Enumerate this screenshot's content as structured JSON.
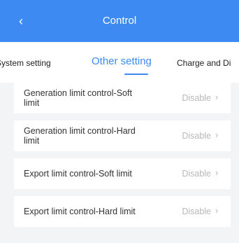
{
  "header": {
    "title": "Control",
    "back_icon": "chevron-left-icon"
  },
  "tabs": [
    {
      "label": "System setting"
    },
    {
      "label": "Other setting",
      "active": true
    },
    {
      "label": "Charge and Di"
    }
  ],
  "items": [
    {
      "label": "Generation limit control-Soft limit",
      "value": "Disable"
    },
    {
      "label": "Generation limit control-Hard limit",
      "value": "Disable"
    },
    {
      "label": "Export limit control-Soft limit",
      "value": "Disable"
    },
    {
      "label": "Export limit control-Hard limit",
      "value": "Disable"
    }
  ],
  "colors": {
    "primary": "#3d8bf2",
    "background": "#f3f4f6",
    "muted_text": "#b8b8b8"
  }
}
